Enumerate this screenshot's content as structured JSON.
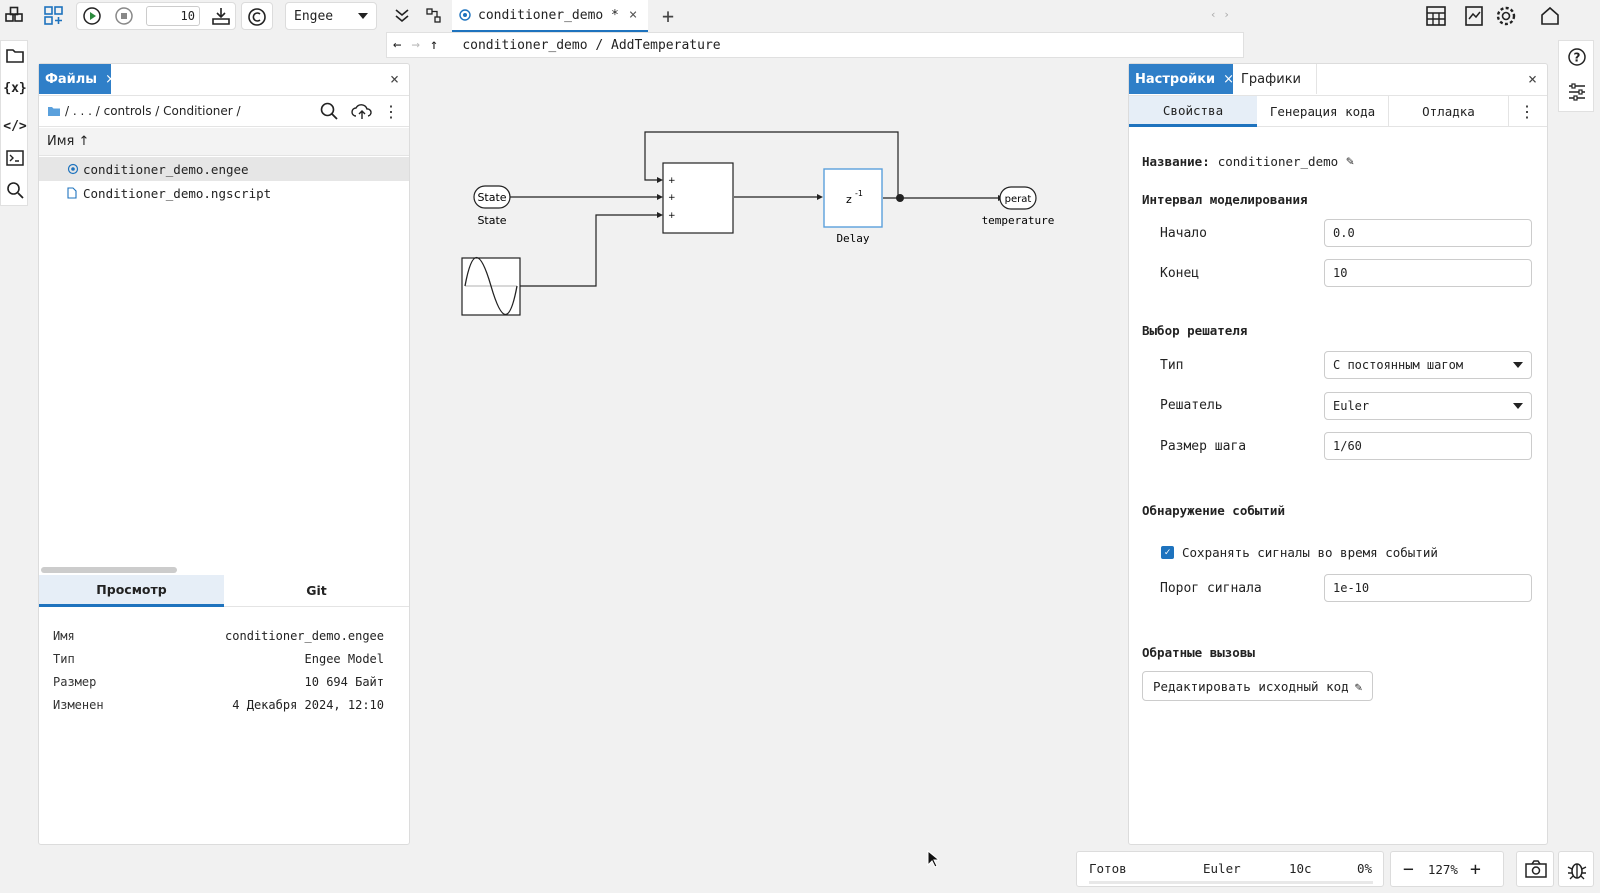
{
  "toolbar": {
    "step_value": "10",
    "engine_select": "Engee",
    "tab_title": "conditioner_demo *",
    "breadcrumb": "conditioner_demo / AddTemperature"
  },
  "files_panel": {
    "tab_label": "Файлы",
    "path": "/ . . . / controls / Conditioner /",
    "column_header": "Имя ↑",
    "files": [
      {
        "name": "conditioner_demo.engee"
      },
      {
        "name": "Conditioner_demo.ngscript"
      }
    ],
    "bottom_tabs": [
      "Просмотр",
      "Git"
    ],
    "info": [
      {
        "key": "Имя",
        "value": "conditioner_demo.engee"
      },
      {
        "key": "Тип",
        "value": "Engee Model"
      },
      {
        "key": "Размер",
        "value": "10 694 Байт"
      },
      {
        "key": "Изменен",
        "value": "4 Декабря 2024, 12:10"
      }
    ]
  },
  "diagram": {
    "state_in_label": "State",
    "state_in_caption": "State",
    "delay_symbol": "z",
    "delay_exp": "-1",
    "delay_caption": "Delay",
    "out_label": "perat",
    "out_caption": "temperature",
    "sum_signs": [
      "+",
      "+",
      "+"
    ]
  },
  "settings_panel": {
    "tab_settings": "Настройки",
    "tab_graphs": "Графики",
    "subtabs": [
      "Свойства",
      "Генерация кода",
      "Отладка"
    ],
    "name_label": "Название:",
    "name_value": "conditioner_demo",
    "section_sim": "Интервал моделирования",
    "start_label": "Начало",
    "start_value": "0.0",
    "end_label": "Конец",
    "end_value": "10",
    "section_solver": "Выбор решателя",
    "type_label": "Тип",
    "type_value": "С постоянным шагом",
    "solver_label": "Решатель",
    "solver_value": "Euler",
    "step_label": "Размер шага",
    "step_value": "1/60",
    "section_events": "Обнаружение событий",
    "save_signals_label": "Сохранять сигналы во время событий",
    "save_signals_checked": true,
    "threshold_label": "Порог сигнала",
    "threshold_value": "1e-10",
    "section_callbacks": "Обратные вызовы",
    "edit_source_button": "Редактировать исходный код"
  },
  "status_bar": {
    "status": "Готов",
    "solver": "Euler",
    "time": "10с",
    "progress": "0%",
    "zoom": "127%"
  },
  "colors": {
    "accent": "#1e73be",
    "active_tab": "#2f7fc8"
  }
}
